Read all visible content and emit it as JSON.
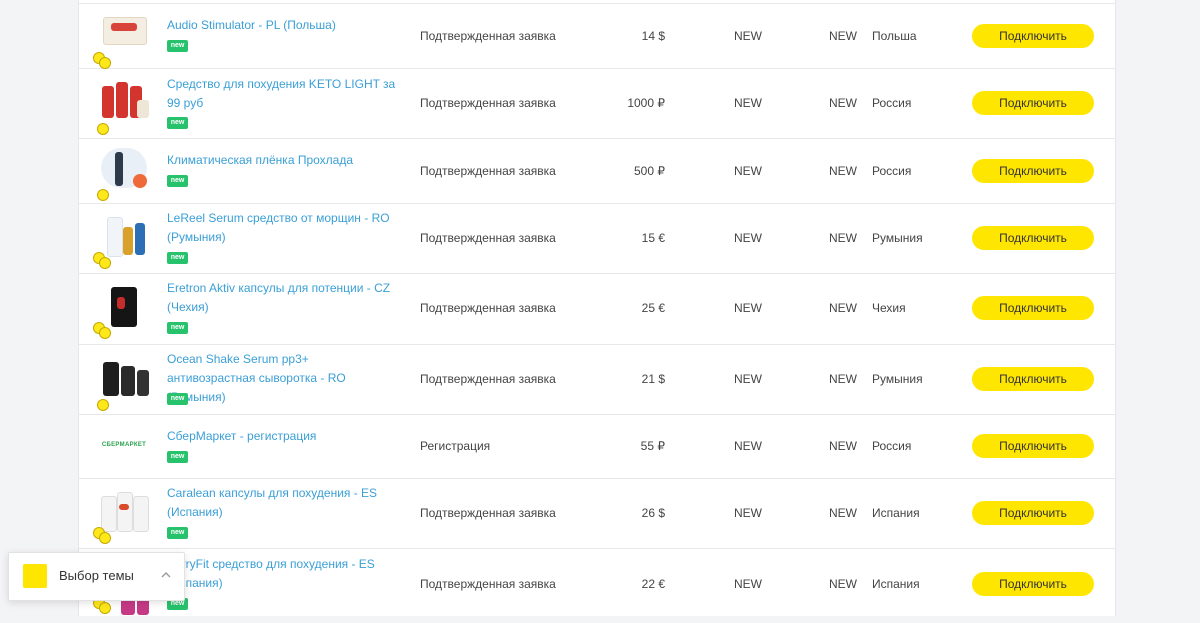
{
  "offers": [
    {
      "name": "Audio Stimulator - PL (Польша)",
      "badge": "new",
      "type": "Подтвержденная заявка",
      "payout": "14 $",
      "status1": "NEW",
      "status2": "NEW",
      "geo": "Польша",
      "button": "Подключить"
    },
    {
      "name": "Средство для похудения KETO LIGHT за 99 руб",
      "badge": "new",
      "type": "Подтвержденная заявка",
      "payout": "1000 ₽",
      "status1": "NEW",
      "status2": "NEW",
      "geo": "Россия",
      "button": "Подключить"
    },
    {
      "name": "Климатическая плёнка Прохлада",
      "badge": "new",
      "type": "Подтвержденная заявка",
      "payout": "500 ₽",
      "status1": "NEW",
      "status2": "NEW",
      "geo": "Россия",
      "button": "Подключить"
    },
    {
      "name": "LeReel Serum средство от морщин - RO (Румыния)",
      "badge": "new",
      "type": "Подтвержденная заявка",
      "payout": "15 €",
      "status1": "NEW",
      "status2": "NEW",
      "geo": "Румыния",
      "button": "Подключить"
    },
    {
      "name": "Eretron Aktiv капсулы для потенции - CZ (Чехия)",
      "badge": "new",
      "type": "Подтвержденная заявка",
      "payout": "25 €",
      "status1": "NEW",
      "status2": "NEW",
      "geo": "Чехия",
      "button": "Подключить"
    },
    {
      "name": "Ocean Shake Serum pp3+ антивозрастная сыворотка - RO (Румыния)",
      "badge": "new",
      "type": "Подтвержденная заявка",
      "payout": "21 $",
      "status1": "NEW",
      "status2": "NEW",
      "geo": "Румыния",
      "button": "Подключить"
    },
    {
      "name": "СберМаркет - регистрация",
      "badge": "new",
      "type": "Регистрация",
      "payout": "55 ₽",
      "status1": "NEW",
      "status2": "NEW",
      "geo": "Россия",
      "button": "Подключить",
      "logo_text": "СБЕРМАРКЕТ"
    },
    {
      "name": "Caralean капсулы для похудения - ES (Испания)",
      "badge": "new",
      "type": "Подтвержденная заявка",
      "payout": "26 $",
      "status1": "NEW",
      "status2": "NEW",
      "geo": "Испания",
      "button": "Подключить"
    },
    {
      "name": "BerryFit средство для похудения - ES (Испания)",
      "badge": "new",
      "type": "Подтвержденная заявка",
      "payout": "22 €",
      "status1": "NEW",
      "status2": "NEW",
      "geo": "Испания",
      "button": "Подключить"
    }
  ],
  "theme_picker": {
    "label": "Выбор темы",
    "swatch_color": "#ffe600"
  },
  "colors": {
    "accent": "#ffe600",
    "link": "#3a9fd6",
    "badge": "#27c26c"
  }
}
